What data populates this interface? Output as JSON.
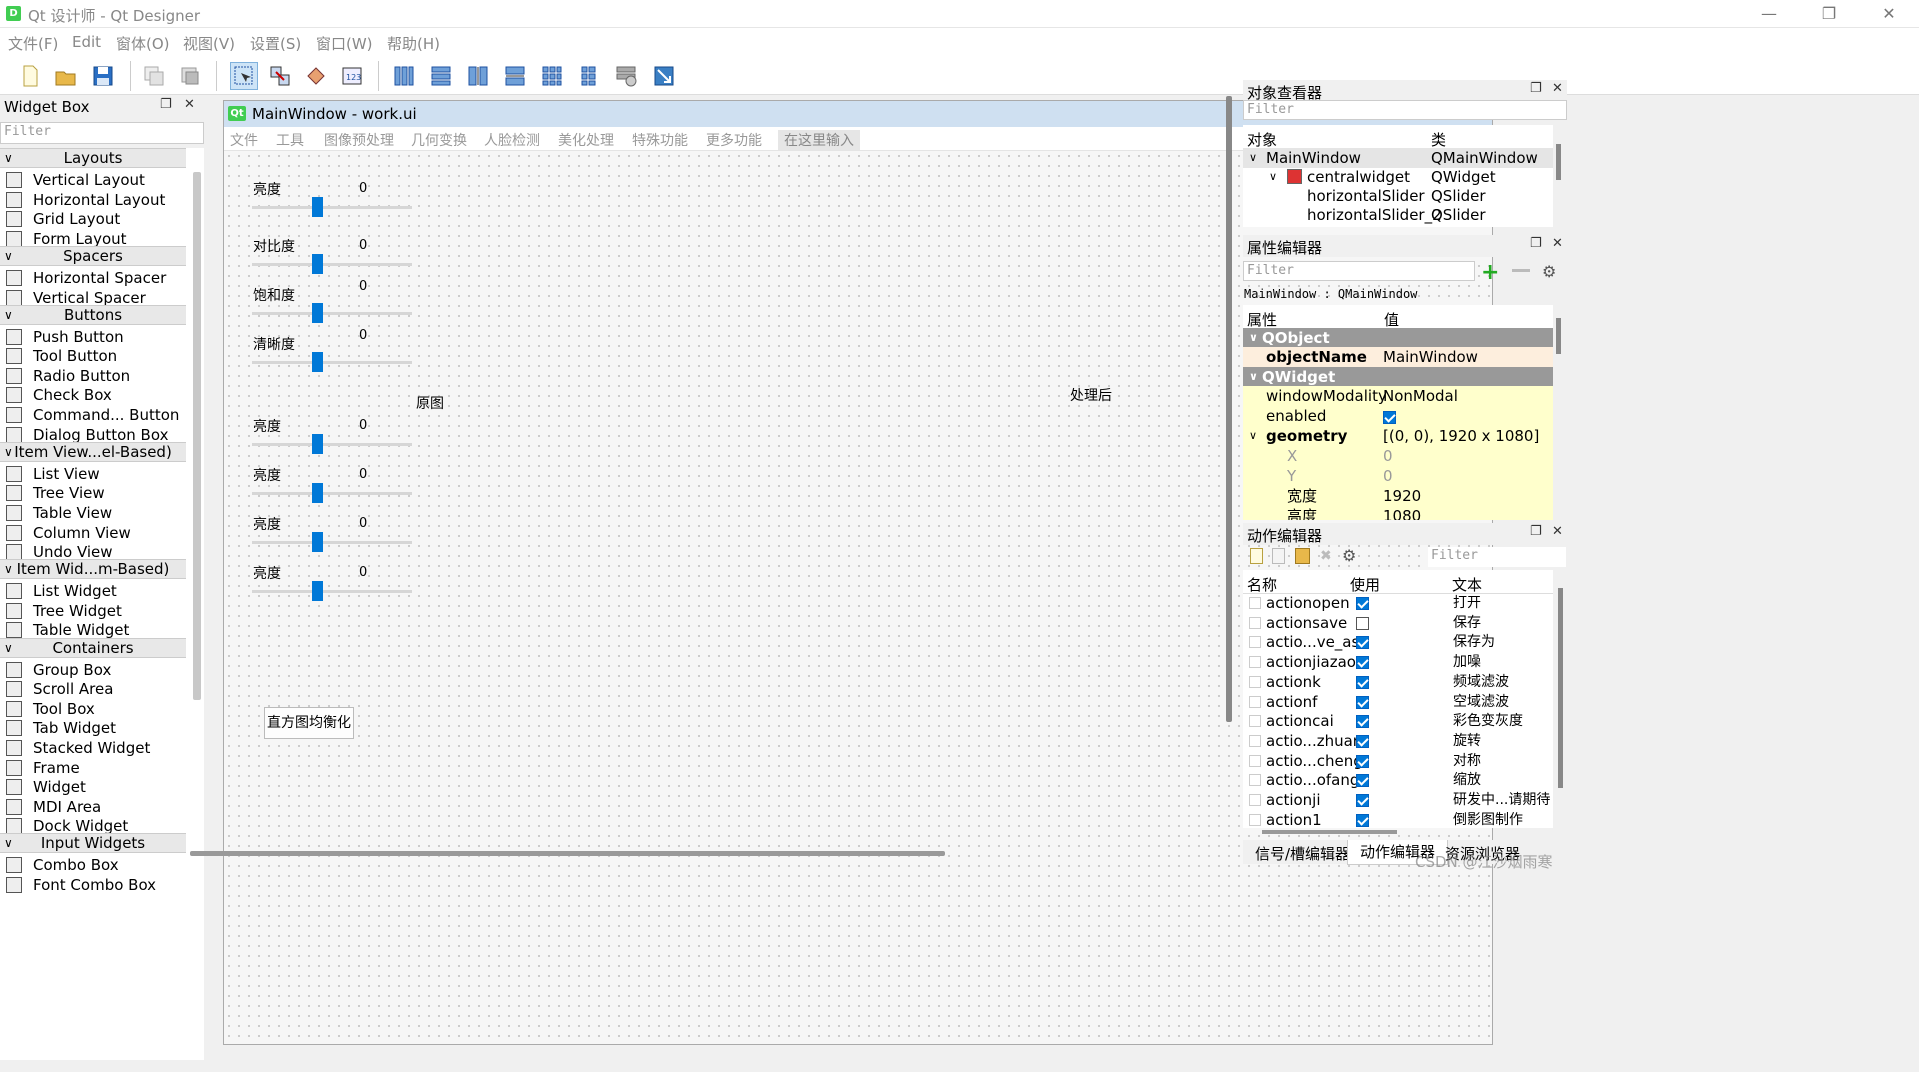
{
  "window": {
    "title": "Qt 设计师 - Qt Designer",
    "app_icon": "D"
  },
  "menu": [
    "文件(F)",
    "Edit",
    "窗体(O)",
    "视图(V)",
    "设置(S)",
    "窗口(W)",
    "帮助(H)"
  ],
  "toolbar_icons": [
    "new-file-icon",
    "open-folder-icon",
    "save-icon",
    "copy-icon",
    "paste-icon",
    "edit-widgets-icon",
    "edit-signals-icon",
    "edit-buddies-icon",
    "edit-tab-order-icon",
    "layout-horizontal-icon",
    "layout-vertical-icon",
    "layout-h-splitter-icon",
    "layout-v-splitter-icon",
    "layout-grid-icon",
    "layout-form-icon",
    "break-layout-icon",
    "adjust-size-icon"
  ],
  "widget_box": {
    "title": "Widget Box",
    "filter_placeholder": "Filter",
    "categories": [
      {
        "name": "Layouts",
        "items": [
          "Vertical Layout",
          "Horizontal Layout",
          "Grid Layout",
          "Form Layout"
        ]
      },
      {
        "name": "Spacers",
        "items": [
          "Horizontal Spacer",
          "Vertical Spacer"
        ]
      },
      {
        "name": "Buttons",
        "items": [
          "Push Button",
          "Tool Button",
          "Radio Button",
          "Check Box",
          "Command... Button",
          "Dialog Button Box"
        ]
      },
      {
        "name": "Item View...el-Based)",
        "items": [
          "List View",
          "Tree View",
          "Table View",
          "Column View",
          "Undo View"
        ]
      },
      {
        "name": "Item Wid...m-Based)",
        "items": [
          "List Widget",
          "Tree Widget",
          "Table Widget"
        ]
      },
      {
        "name": "Containers",
        "items": [
          "Group Box",
          "Scroll Area",
          "Tool Box",
          "Tab Widget",
          "Stacked Widget",
          "Frame",
          "Widget",
          "MDI Area",
          "Dock Widget"
        ]
      },
      {
        "name": "Input Widgets",
        "items": [
          "Combo Box",
          "Font Combo Box"
        ]
      }
    ]
  },
  "form": {
    "window_title": "MainWindow - work.ui",
    "qt_badge": "Qt",
    "menus": [
      "文件",
      "工具",
      "图像预处理",
      "几何变换",
      "人脸检测",
      "美化处理",
      "特殊功能",
      "更多功能"
    ],
    "type_here": "在这里输入",
    "sliders": [
      {
        "label": "亮度",
        "value": "0"
      },
      {
        "label": "对比度",
        "value": "0"
      },
      {
        "label": "饱和度",
        "value": "0"
      },
      {
        "label": "清晰度",
        "value": "0"
      },
      {
        "label": "亮度",
        "value": "0"
      },
      {
        "label": "亮度",
        "value": "0"
      },
      {
        "label": "亮度",
        "value": "0"
      },
      {
        "label": "亮度",
        "value": "0"
      }
    ],
    "original_label": "原图",
    "processed_label": "处理后",
    "hist_button": "直方图均衡化"
  },
  "object_inspector": {
    "title": "对象查看器",
    "filter_placeholder": "Filter",
    "col_object": "对象",
    "col_class": "类",
    "rows": [
      {
        "object": "MainWindow",
        "class": "QMainWindow"
      },
      {
        "object": "centralwidget",
        "class": "QWidget"
      },
      {
        "object": "horizontalSlider",
        "class": "QSlider"
      },
      {
        "object": "horizontalSlider_2",
        "class": "QSlider"
      }
    ]
  },
  "property_editor": {
    "title": "属性编辑器",
    "filter_placeholder": "Filter",
    "context": "MainWindow : QMainWindow",
    "col_property": "属性",
    "col_value": "值",
    "groups": {
      "qobject": "QObject",
      "qwidget": "QWidget"
    },
    "props": {
      "objectName": {
        "key": "objectName",
        "value": "MainWindow"
      },
      "windowModality": {
        "key": "windowModality",
        "value": "NonModal"
      },
      "enabled": {
        "key": "enabled",
        "value": "true"
      },
      "geometry": {
        "key": "geometry",
        "value": "[(0, 0), 1920 x 1080]"
      },
      "x": {
        "key": "X",
        "value": "0"
      },
      "y": {
        "key": "Y",
        "value": "0"
      },
      "width": {
        "key": "宽度",
        "value": "1920"
      },
      "height": {
        "key": "高度",
        "value": "1080"
      }
    }
  },
  "action_editor": {
    "title": "动作编辑器",
    "filter_placeholder": "Filter",
    "col_name": "名称",
    "col_used": "使用",
    "col_text": "文本",
    "actions": [
      {
        "name": "actionopen",
        "used": true,
        "text": "打开"
      },
      {
        "name": "actionsave",
        "used": false,
        "text": "保存"
      },
      {
        "name": "actio...ve_as",
        "used": true,
        "text": "保存为"
      },
      {
        "name": "actionjiazao",
        "used": true,
        "text": "加噪"
      },
      {
        "name": "actionk",
        "used": true,
        "text": "频域滤波"
      },
      {
        "name": "actionf",
        "used": true,
        "text": "空域滤波"
      },
      {
        "name": "actioncai",
        "used": true,
        "text": "彩色变灰度"
      },
      {
        "name": "actio...zhuan",
        "used": true,
        "text": "旋转"
      },
      {
        "name": "actio...cheng",
        "used": true,
        "text": "对称"
      },
      {
        "name": "actio...ofang",
        "used": true,
        "text": "缩放"
      },
      {
        "name": "actionji",
        "used": true,
        "text": "研发中...请期待"
      },
      {
        "name": "action1",
        "used": true,
        "text": "倒影图制作"
      }
    ]
  },
  "bottom_tabs": [
    "信号/槽编辑器",
    "动作编辑器",
    "资源浏览器"
  ],
  "watermark": "CSDN @江沙烟雨寒",
  "colors": {
    "accent": "#0078d7",
    "qt_green": "#41cd52",
    "group_bg": "#999999",
    "prop_yellow": "#ffffcc",
    "prop_orange": "#fdeedd"
  }
}
